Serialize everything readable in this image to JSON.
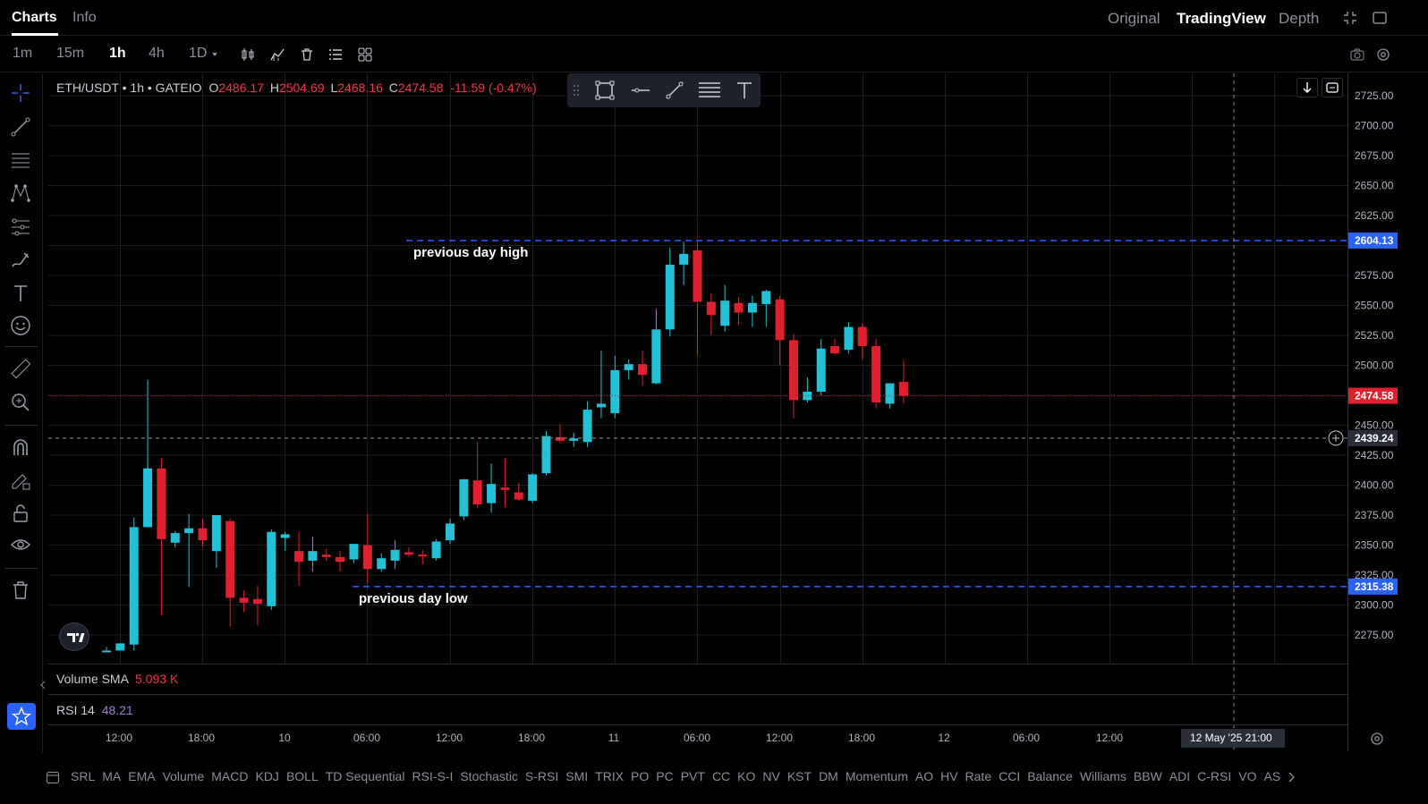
{
  "header": {
    "tabs": [
      "Charts",
      "Info"
    ],
    "views": [
      "Original",
      "TradingView",
      "Depth"
    ]
  },
  "toolbar": {
    "intervals": [
      "1m",
      "15m",
      "1h",
      "4h",
      "1D"
    ]
  },
  "legend": {
    "symbol": "ETH/USDT • 1h • GATEIO",
    "o_label": "O",
    "o": "2486.17",
    "h_label": "H",
    "h": "2504.69",
    "l_label": "L",
    "l": "2468.16",
    "c_label": "C",
    "c": "2474.58",
    "change": "-11.59 (-0.47%)"
  },
  "annotations": {
    "high": "previous day high",
    "low": "previous day low"
  },
  "price_axis": {
    "ticks": [
      "2725.00",
      "2700.00",
      "2675.00",
      "2650.00",
      "2625.00",
      "2575.00",
      "2550.00",
      "2525.00",
      "2500.00",
      "2450.00",
      "2425.00",
      "2400.00",
      "2375.00",
      "2350.00",
      "2325.00",
      "2300.00",
      "2275.00"
    ],
    "high_line": "2604.13",
    "last_price": "2474.58",
    "cursor_price": "2439.24",
    "low_line": "2315.38"
  },
  "panels": {
    "volume_label": "Volume SMA",
    "volume_value": "5.093 K",
    "rsi_label": "RSI 14",
    "rsi_value": "48.21"
  },
  "time_axis": {
    "labels": [
      "12:00",
      "18:00",
      "10",
      "06:00",
      "12:00",
      "18:00",
      "11",
      "06:00",
      "12:00",
      "18:00",
      "12",
      "06:00",
      "12:00"
    ],
    "cursor": "12 May '25   21:00"
  },
  "indicators": [
    "SRL",
    "MA",
    "EMA",
    "Volume",
    "MACD",
    "KDJ",
    "BOLL",
    "TD Sequential",
    "RSI-S-I",
    "Stochastic",
    "S-RSI",
    "SMI",
    "TRIX",
    "PO",
    "PC",
    "PVT",
    "CC",
    "KO",
    "NV",
    "KST",
    "DM",
    "Momentum",
    "AO",
    "HV",
    "Rate",
    "CCI",
    "Balance",
    "Williams",
    "BBW",
    "ADI",
    "C-RSI",
    "VO",
    "AS"
  ],
  "colors": {
    "up": "#22c1d6",
    "down": "#e0202f",
    "guide_line": "#2962ff",
    "accent": "#2962ff"
  },
  "chart_data": {
    "type": "candlestick",
    "title": "ETH/USDT • 1h • GATEIO",
    "ylim": [
      2262,
      2735
    ],
    "candles": [
      {
        "o": 2262,
        "h": 2265,
        "l": 2262,
        "c": 2262
      },
      {
        "o": 2262,
        "h": 2268,
        "l": 2262,
        "c": 2268
      },
      {
        "o": 2267,
        "h": 2373,
        "l": 2262,
        "c": 2365
      },
      {
        "o": 2365,
        "h": 2488,
        "l": 2365,
        "c": 2414
      },
      {
        "o": 2414,
        "h": 2422,
        "l": 2292,
        "c": 2355
      },
      {
        "o": 2352,
        "h": 2362,
        "l": 2348,
        "c": 2360
      },
      {
        "o": 2360,
        "h": 2376,
        "l": 2315,
        "c": 2364
      },
      {
        "o": 2364,
        "h": 2372,
        "l": 2349,
        "c": 2354
      },
      {
        "o": 2345,
        "h": 2374,
        "l": 2331,
        "c": 2375
      },
      {
        "o": 2370,
        "h": 2372,
        "l": 2282,
        "c": 2306
      },
      {
        "o": 2306,
        "h": 2312,
        "l": 2294,
        "c": 2302
      },
      {
        "o": 2305,
        "h": 2316,
        "l": 2283,
        "c": 2301
      },
      {
        "o": 2299,
        "h": 2363,
        "l": 2296,
        "c": 2361
      },
      {
        "o": 2356,
        "h": 2361,
        "l": 2345,
        "c": 2359
      },
      {
        "o": 2345,
        "h": 2361,
        "l": 2316,
        "c": 2336
      },
      {
        "o": 2337,
        "h": 2357,
        "l": 2328,
        "c": 2345
      },
      {
        "o": 2342,
        "h": 2347,
        "l": 2337,
        "c": 2340
      },
      {
        "o": 2340,
        "h": 2345,
        "l": 2328,
        "c": 2336
      },
      {
        "o": 2338,
        "h": 2351,
        "l": 2335,
        "c": 2351
      },
      {
        "o": 2350,
        "h": 2376,
        "l": 2318,
        "c": 2330
      },
      {
        "o": 2330,
        "h": 2343,
        "l": 2328,
        "c": 2339
      },
      {
        "o": 2337,
        "h": 2354,
        "l": 2330,
        "c": 2346
      },
      {
        "o": 2344,
        "h": 2348,
        "l": 2340,
        "c": 2342
      },
      {
        "o": 2342,
        "h": 2346,
        "l": 2334,
        "c": 2341
      },
      {
        "o": 2339,
        "h": 2355,
        "l": 2337,
        "c": 2353
      },
      {
        "o": 2354,
        "h": 2372,
        "l": 2351,
        "c": 2368
      },
      {
        "o": 2374,
        "h": 2405,
        "l": 2371,
        "c": 2405
      },
      {
        "o": 2404,
        "h": 2436,
        "l": 2381,
        "c": 2384
      },
      {
        "o": 2385,
        "h": 2418,
        "l": 2377,
        "c": 2401
      },
      {
        "o": 2398,
        "h": 2422,
        "l": 2382,
        "c": 2396
      },
      {
        "o": 2394,
        "h": 2402,
        "l": 2387,
        "c": 2388
      },
      {
        "o": 2387,
        "h": 2410,
        "l": 2385,
        "c": 2409
      },
      {
        "o": 2410,
        "h": 2445,
        "l": 2408,
        "c": 2441
      },
      {
        "o": 2440,
        "h": 2451,
        "l": 2435,
        "c": 2437
      },
      {
        "o": 2437,
        "h": 2444,
        "l": 2432,
        "c": 2439
      },
      {
        "o": 2436,
        "h": 2470,
        "l": 2432,
        "c": 2463
      },
      {
        "o": 2465,
        "h": 2512,
        "l": 2456,
        "c": 2468
      },
      {
        "o": 2460,
        "h": 2508,
        "l": 2456,
        "c": 2496
      },
      {
        "o": 2496,
        "h": 2505,
        "l": 2488,
        "c": 2501
      },
      {
        "o": 2501,
        "h": 2512,
        "l": 2483,
        "c": 2492
      },
      {
        "o": 2485,
        "h": 2547,
        "l": 2484,
        "c": 2530
      },
      {
        "o": 2530,
        "h": 2598,
        "l": 2524,
        "c": 2584
      },
      {
        "o": 2584,
        "h": 2603,
        "l": 2567,
        "c": 2593
      },
      {
        "o": 2596,
        "h": 2604,
        "l": 2508,
        "c": 2553
      },
      {
        "o": 2553,
        "h": 2560,
        "l": 2525,
        "c": 2542
      },
      {
        "o": 2533,
        "h": 2567,
        "l": 2528,
        "c": 2554
      },
      {
        "o": 2552,
        "h": 2557,
        "l": 2534,
        "c": 2544
      },
      {
        "o": 2544,
        "h": 2558,
        "l": 2532,
        "c": 2552
      },
      {
        "o": 2551,
        "h": 2563,
        "l": 2532,
        "c": 2562
      },
      {
        "o": 2555,
        "h": 2558,
        "l": 2500,
        "c": 2521
      },
      {
        "o": 2521,
        "h": 2526,
        "l": 2456,
        "c": 2471
      },
      {
        "o": 2471,
        "h": 2490,
        "l": 2469,
        "c": 2478
      },
      {
        "o": 2478,
        "h": 2522,
        "l": 2475,
        "c": 2514
      },
      {
        "o": 2516,
        "h": 2522,
        "l": 2509,
        "c": 2510
      },
      {
        "o": 2513,
        "h": 2536,
        "l": 2510,
        "c": 2532
      },
      {
        "o": 2532,
        "h": 2535,
        "l": 2505,
        "c": 2516
      },
      {
        "o": 2516,
        "h": 2522,
        "l": 2464,
        "c": 2469
      },
      {
        "o": 2468,
        "h": 2485,
        "l": 2464,
        "c": 2485
      },
      {
        "o": 2486.17,
        "h": 2504.69,
        "l": 2468.16,
        "c": 2474.58
      }
    ],
    "guides": [
      {
        "label": "previous day high",
        "value": 2604.13
      },
      {
        "label": "previous day low",
        "value": 2315.38
      }
    ]
  }
}
